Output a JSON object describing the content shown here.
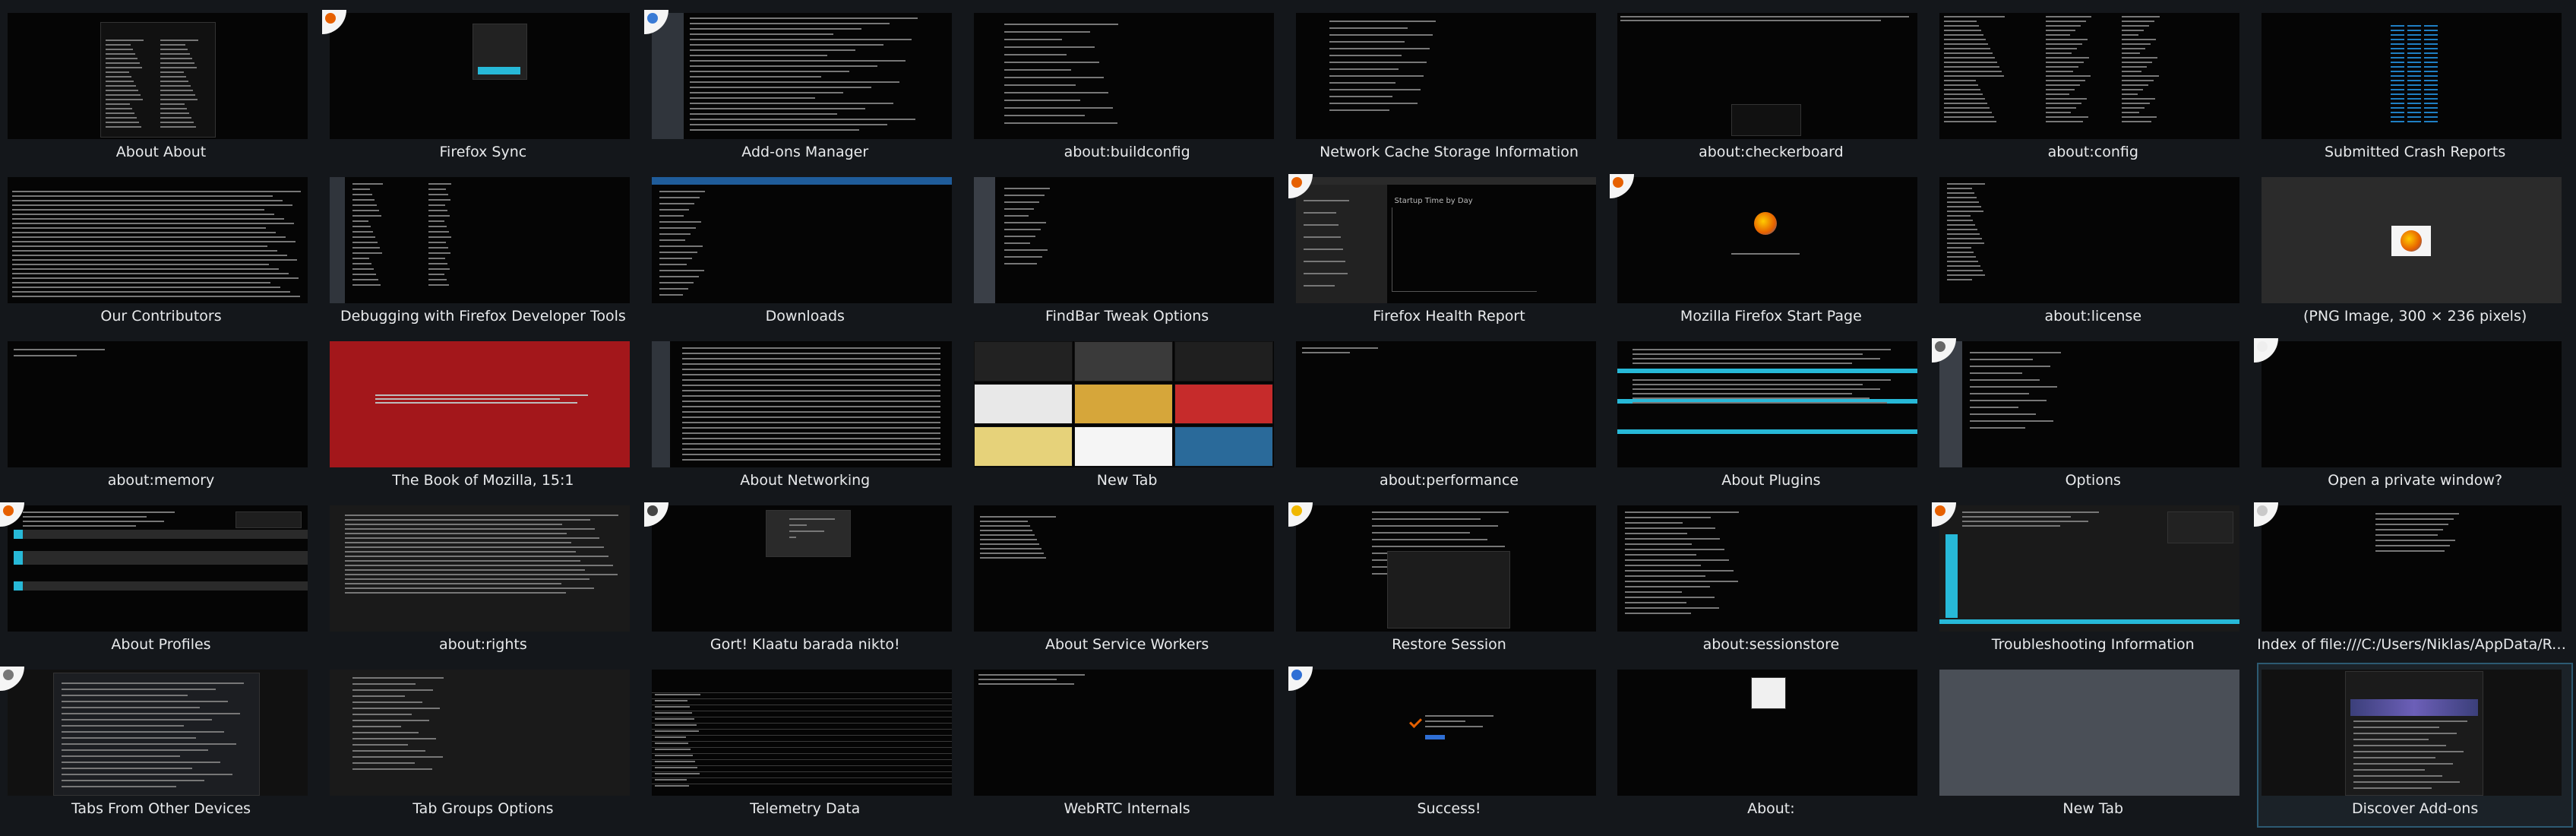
{
  "window_title": "New Tab",
  "colors": {
    "background": "#14171b",
    "tile_text": "#e8eaec",
    "selected_border": "#2c5a72",
    "accent_cyan": "#27b9d8",
    "book_red": "#a3171b",
    "blank_tab_gray": "#4a4f57"
  },
  "tiles": [
    {
      "title": "About About",
      "icon": "none"
    },
    {
      "title": "Firefox Sync",
      "icon": "firefox-icon"
    },
    {
      "title": "Add-ons Manager",
      "icon": "puzzle-icon"
    },
    {
      "title": "about:buildconfig",
      "icon": "none"
    },
    {
      "title": "Network Cache Storage Information",
      "icon": "none"
    },
    {
      "title": "about:checkerboard",
      "icon": "none"
    },
    {
      "title": "about:config",
      "icon": "none"
    },
    {
      "title": "Submitted Crash Reports",
      "icon": "none"
    },
    {
      "title": "Our Contributors",
      "icon": "none"
    },
    {
      "title": "Debugging with Firefox Developer Tools",
      "icon": "none"
    },
    {
      "title": "Downloads",
      "icon": "none"
    },
    {
      "title": "FindBar Tweak Options",
      "icon": "none"
    },
    {
      "title": "Firefox Health Report",
      "icon": "firefox-icon"
    },
    {
      "title": "Mozilla Firefox Start Page",
      "icon": "firefox-icon"
    },
    {
      "title": "about:license",
      "icon": "none"
    },
    {
      "title": "(PNG Image, 300 × 236 pixels)",
      "icon": "none"
    },
    {
      "title": "about:memory",
      "icon": "none"
    },
    {
      "title": "The Book of Mozilla, 15:1",
      "icon": "none"
    },
    {
      "title": "About Networking",
      "icon": "none"
    },
    {
      "title": "New Tab",
      "icon": "none"
    },
    {
      "title": "about:performance",
      "icon": "none"
    },
    {
      "title": "About Plugins",
      "icon": "none"
    },
    {
      "title": "Options",
      "icon": "gear-icon"
    },
    {
      "title": "Open a private window?",
      "icon": "blank-icon"
    },
    {
      "title": "About Profiles",
      "icon": "firefox-icon"
    },
    {
      "title": "about:rights",
      "icon": "none"
    },
    {
      "title": "Gort! Klaatu barada nikto!",
      "icon": "robot-icon"
    },
    {
      "title": "About Service Workers",
      "icon": "none"
    },
    {
      "title": "Restore Session",
      "icon": "warning-icon"
    },
    {
      "title": "about:sessionstore",
      "icon": "none"
    },
    {
      "title": "Troubleshooting Information",
      "icon": "firefox-icon"
    },
    {
      "title": "Index of file:///C:/Users/Niklas/AppData/Roam...",
      "icon": "folder-icon"
    },
    {
      "title": "Tabs From Other Devices",
      "icon": "sync-icon"
    },
    {
      "title": "Tab Groups Options",
      "icon": "none"
    },
    {
      "title": "Telemetry Data",
      "icon": "none"
    },
    {
      "title": "WebRTC Internals",
      "icon": "none"
    },
    {
      "title": "Success!",
      "icon": "info-icon"
    },
    {
      "title": "About:",
      "icon": "none"
    },
    {
      "title": "New Tab",
      "icon": "none"
    },
    {
      "title": "Discover Add-ons",
      "icon": "none"
    }
  ],
  "thumb_text": {
    "about_about_heading": "About About",
    "health_chart_title": "Startup Time by Day"
  }
}
